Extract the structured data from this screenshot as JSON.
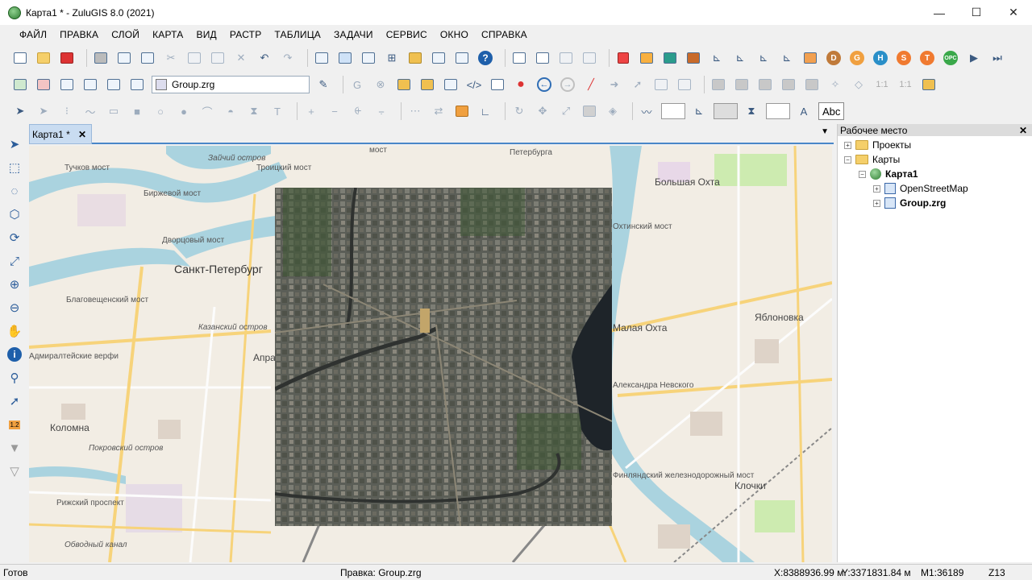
{
  "window": {
    "title": "Карта1 * - ZuluGIS 8.0 (2021)",
    "minimize": "—",
    "maximize": "☐",
    "close": "✕"
  },
  "menu": [
    "Файл",
    "Правка",
    "Слой",
    "Карта",
    "Вид",
    "Растр",
    "Таблица",
    "Задачи",
    "Сервис",
    "Окно",
    "Справка"
  ],
  "toolbar2": {
    "layer_combo": "Group.zrg",
    "scale_label_1": "1:1",
    "scale_label_2": "1:1"
  },
  "toolbar3": {
    "text_tool": "T",
    "font_button": "A",
    "style_button": "Abc"
  },
  "toolbar1": {
    "plugin_buttons": [
      "D",
      "G",
      "H",
      "S",
      "T",
      "OPC"
    ]
  },
  "tab": {
    "label": "Карта1 *",
    "close": "✕",
    "dropdown": "▼"
  },
  "map": {
    "labels": [
      "Тучков мост",
      "Зайчий остров",
      "Троицкий мост",
      "Биржевой мост",
      "Дворцовый мост",
      "Санкт-Петербург",
      "Благовещенский мост",
      "Казанский остров",
      "Адмиралтейские верфи",
      "Коломна",
      "Покровский остров",
      "Апра",
      "Большая Охта",
      "Охтинский мост",
      "Малая Охта",
      "Яблоновка",
      "Александра Невского",
      "Финляндский железнодорожный мост",
      "Клочки",
      "Петербурга",
      "мост",
      "Рижский проспект",
      "Обводный канал"
    ]
  },
  "workspace": {
    "title": "Рабочее место",
    "close": "✕",
    "tree": {
      "projects": "Проекты",
      "maps": "Карты",
      "map1": "Карта1",
      "layer1": "OpenStreetMap",
      "layer2": "Group.zrg"
    }
  },
  "status": {
    "ready": "Готов",
    "edit": "Правка: Group.zrg",
    "x": "X:8388936.99 м",
    "y": "Y:3371831.84 м",
    "scale": "M1:36189",
    "zoom": "Z13"
  },
  "colors": {
    "accent": "#4a87c8",
    "water": "#aad3df",
    "park": "#cdebb0",
    "road": "#f7d37a"
  }
}
